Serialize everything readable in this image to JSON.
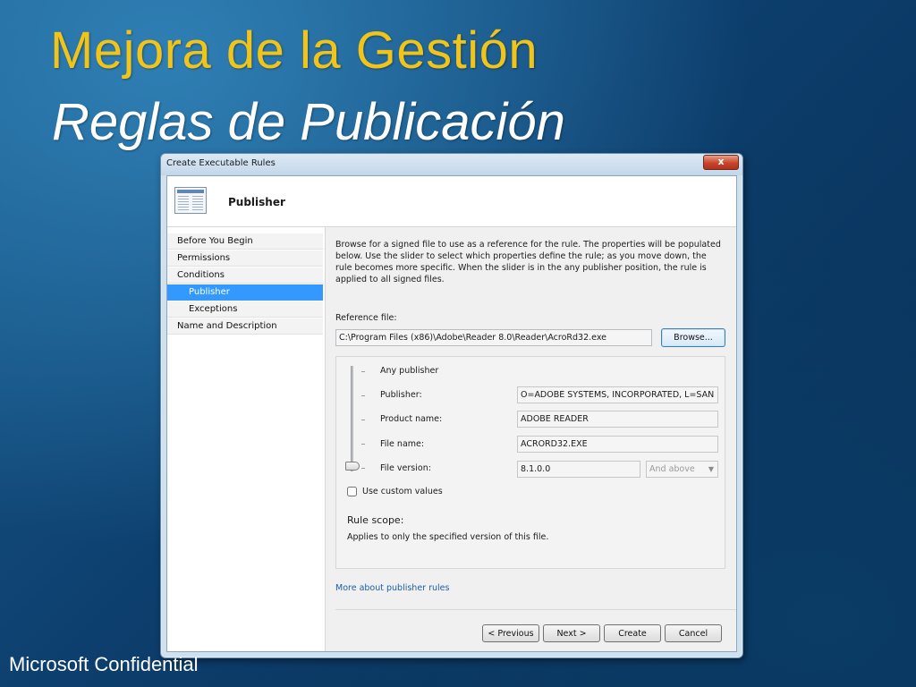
{
  "slide": {
    "title": "Mejora de la Gestión",
    "subtitle": "Reglas de Publicación",
    "footer": "Microsoft Confidential"
  },
  "window": {
    "title": "Create Executable Rules",
    "close_glyph": "x"
  },
  "header": {
    "title": "Publisher"
  },
  "nav": {
    "items": [
      {
        "label": "Before You Begin"
      },
      {
        "label": "Permissions"
      },
      {
        "label": "Conditions"
      },
      {
        "label": "Publisher",
        "active": true
      },
      {
        "label": "Exceptions"
      },
      {
        "label": "Name and Description"
      }
    ]
  },
  "content": {
    "description": "Browse for a signed file to use as a reference for the rule. The properties will be populated below. Use the slider to select which properties define the rule; as you move down, the rule becomes more specific. When the slider is in the any publisher position, the rule is applied to all signed files.",
    "reference_label": "Reference file:",
    "reference_value": "C:\\Program Files (x86)\\Adobe\\Reader 8.0\\Reader\\AcroRd32.exe",
    "browse_label": "Browse...",
    "properties": {
      "any_publisher": "Any publisher",
      "publisher_label": "Publisher:",
      "publisher_value": "O=ADOBE SYSTEMS, INCORPORATED, L=SAN JOSE",
      "product_label": "Product name:",
      "product_value": "ADOBE READER",
      "file_label": "File name:",
      "file_value": "ACRORD32.EXE",
      "version_label": "File version:",
      "version_value": "8.1.0.0",
      "version_operator": "And above",
      "slider_position": "File version"
    },
    "custom_values_label": "Use custom values",
    "custom_values_checked": false,
    "scope_title": "Rule scope:",
    "scope_text": "Applies to only the specified version of this file.",
    "more_link": "More about publisher rules"
  },
  "buttons": {
    "previous": "< Previous",
    "next": "Next >",
    "create": "Create",
    "cancel": "Cancel"
  }
}
